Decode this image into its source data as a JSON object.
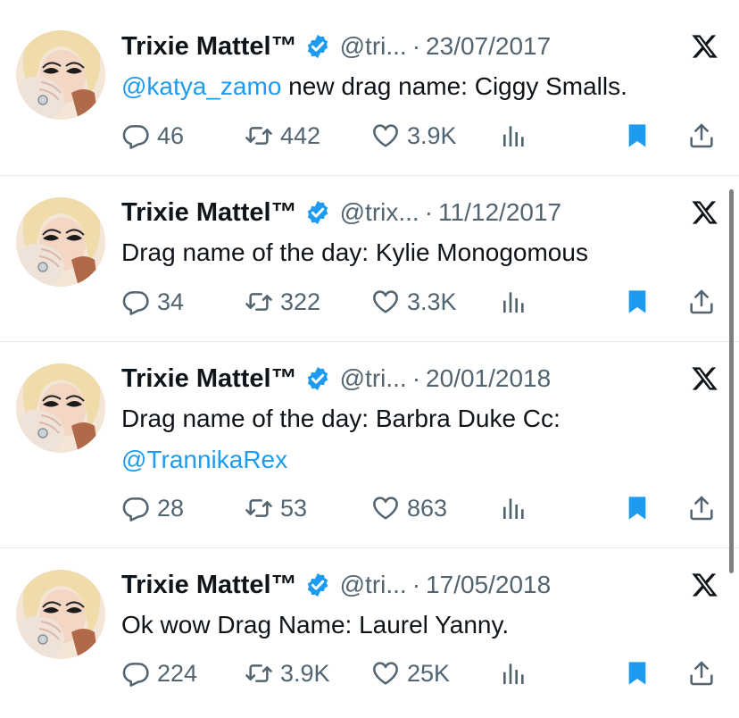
{
  "tweets": [
    {
      "name": "Trixie Mattel™",
      "handle": "@tri...",
      "date": "23/07/2017",
      "text_mention": "@katya_zamo",
      "text_rest": " new drag name: Ciggy Smalls.",
      "replies": "46",
      "reposts": "442",
      "likes": "3.9K"
    },
    {
      "name": "Trixie Mattel™",
      "handle": "@trix...",
      "date": "11/12/2017",
      "text_rest": "Drag name of the day: Kylie Monogomous",
      "replies": "34",
      "reposts": "322",
      "likes": "3.3K"
    },
    {
      "name": "Trixie Mattel™",
      "handle": "@tri...",
      "date": "20/01/2018",
      "text_rest": "Drag name of the day: Barbra Duke Cc:",
      "text_mention2": "@TrannikaRex",
      "replies": "28",
      "reposts": "53",
      "likes": "863"
    },
    {
      "name": "Trixie Mattel™",
      "handle": "@tri...",
      "date": "17/05/2018",
      "text_rest": "Ok wow Drag Name: Laurel Yanny.",
      "replies": "224",
      "reposts": "3.9K",
      "likes": "25K"
    }
  ],
  "separator": "·",
  "colors": {
    "accent": "#1d9bf0",
    "text": "#0f1419",
    "muted": "#536471",
    "divider": "#e6e9ec"
  },
  "icons": [
    "verified-badge-icon",
    "x-logo-icon",
    "reply-icon",
    "repost-icon",
    "like-icon",
    "views-icon",
    "bookmark-icon",
    "share-icon"
  ]
}
